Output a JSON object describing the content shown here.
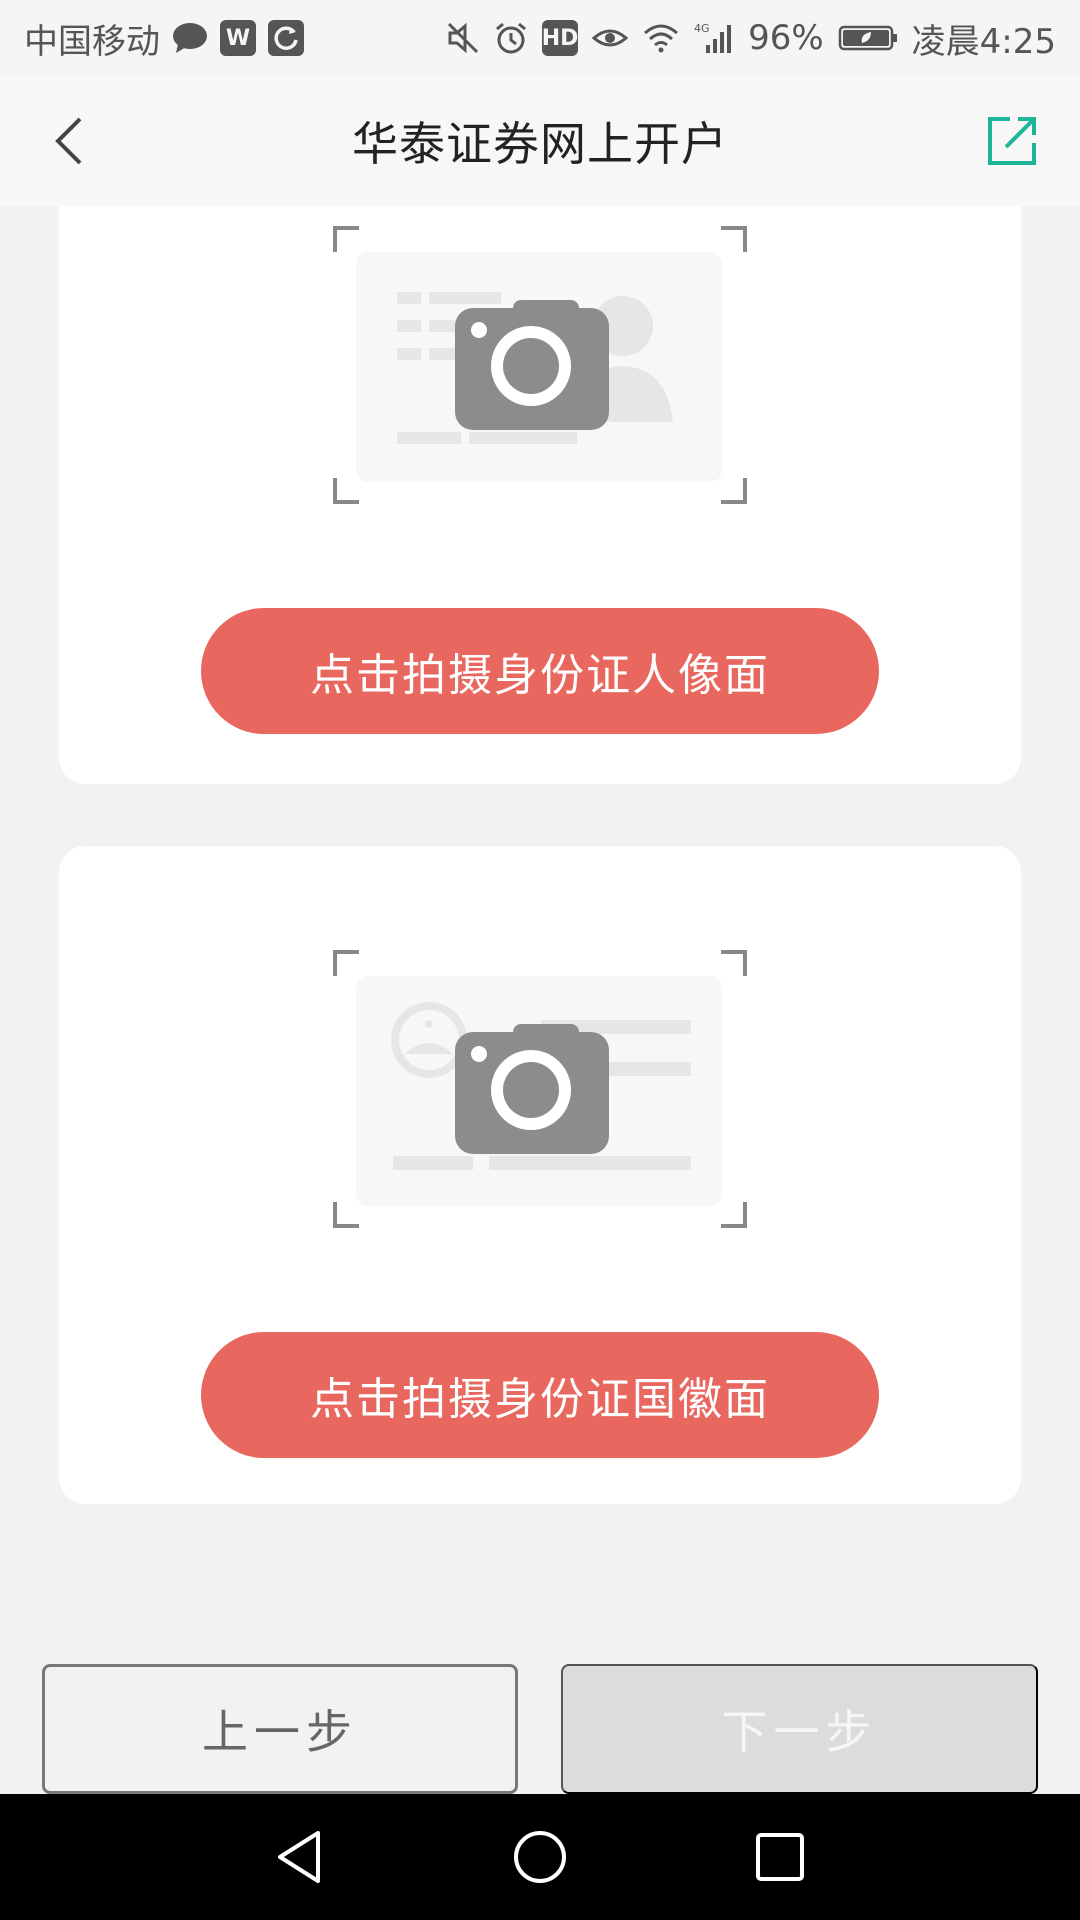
{
  "status_bar": {
    "carrier": "中国移动",
    "hd_label": "HD",
    "network": "4G",
    "battery": "96%",
    "time": "凌晨4:25",
    "icons": [
      "chat-bubble-icon",
      "wps-icon",
      "refresh-app-icon",
      "mute-icon",
      "alarm-icon",
      "hd-icon",
      "eye-icon",
      "wifi-icon",
      "signal-icon",
      "battery-icon"
    ]
  },
  "header": {
    "title": "华泰证券网上开户",
    "back_icon": "chevron-left-icon",
    "share_icon": "external-link-icon",
    "accent": "#1fb59a"
  },
  "cards": [
    {
      "image": "id-card-portrait-side-placeholder",
      "button_label": "点击拍摄身份证人像面"
    },
    {
      "image": "id-card-emblem-side-placeholder",
      "button_label": "点击拍摄身份证国徽面"
    }
  ],
  "actions": {
    "prev_label": "上一步",
    "next_label": "下一步"
  },
  "colors": {
    "primary_button": "#e8685f",
    "disabled_button": "#dcdcdc"
  },
  "nav_bar": {
    "buttons": [
      "nav-back-icon",
      "nav-home-icon",
      "nav-recent-icon"
    ]
  }
}
